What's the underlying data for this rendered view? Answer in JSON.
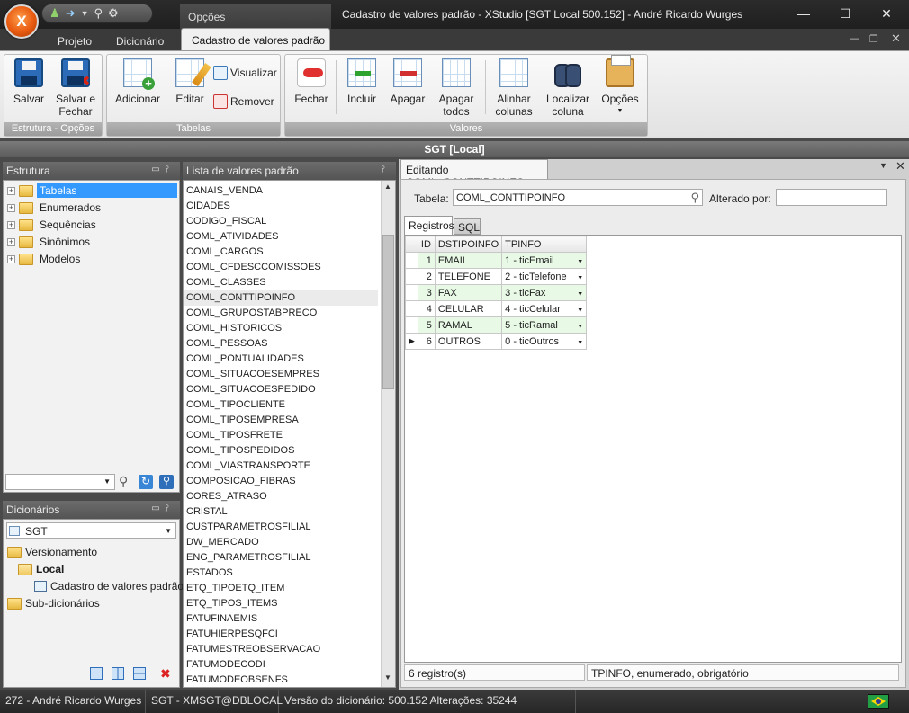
{
  "app": {
    "window_title": "Cadastro de valores padrão - XStudio [SGT Local 500.152] - André Ricardo Wurges",
    "contextual_group": "Opções",
    "logo_letter": "X"
  },
  "ribbon": {
    "tabs": [
      {
        "label": "Projeto"
      },
      {
        "label": "Dicionário"
      },
      {
        "label": "Cadastro de valores padrão"
      }
    ],
    "groups": {
      "estrutura": {
        "caption": "Estrutura - Opções",
        "salvar": "Salvar",
        "salvar_fechar_1": "Salvar e",
        "salvar_fechar_2": "Fechar"
      },
      "tabelas": {
        "caption": "Tabelas",
        "adicionar": "Adicionar",
        "editar": "Editar",
        "visualizar": "Visualizar",
        "remover": "Remover"
      },
      "valores": {
        "caption": "Valores",
        "fechar": "Fechar",
        "incluir": "Incluir",
        "apagar": "Apagar",
        "apagar_todos_1": "Apagar",
        "apagar_todos_2": "todos",
        "alinhar_1": "Alinhar",
        "alinhar_2": "colunas",
        "localizar_1": "Localizar",
        "localizar_2": "coluna",
        "opcoes": "Opções"
      }
    }
  },
  "header_bar": "SGT [Local]",
  "estrutura_panel": {
    "title": "Estrutura",
    "items": [
      "Tabelas",
      "Enumerados",
      "Sequências",
      "Sinônimos",
      "Modelos"
    ],
    "selected": "Tabelas"
  },
  "dicionarios_panel": {
    "title": "Dicionários",
    "selected": "SGT",
    "tree": {
      "versionamento": "Versionamento",
      "local": "Local",
      "cadastro": "Cadastro de valores padrão",
      "sub": "Sub-dicionários"
    }
  },
  "lista_panel": {
    "title": "Lista de valores padrão",
    "selected": "COML_CONTTIPOINFO",
    "items": [
      "CANAIS_VENDA",
      "CIDADES",
      "CODIGO_FISCAL",
      "COML_ATIVIDADES",
      "COML_CARGOS",
      "COML_CFDESCCOMISSOES",
      "COML_CLASSES",
      "COML_CONTTIPOINFO",
      "COML_GRUPOSTABPRECO",
      "COML_HISTORICOS",
      "COML_PESSOAS",
      "COML_PONTUALIDADES",
      "COML_SITUACOESEMPRES",
      "COML_SITUACOESPEDIDO",
      "COML_TIPOCLIENTE",
      "COML_TIPOSEMPRESA",
      "COML_TIPOSFRETE",
      "COML_TIPOSPEDIDOS",
      "COML_VIASTRANSPORTE",
      "COMPOSICAO_FIBRAS",
      "CORES_ATRASO",
      "CRISTAL",
      "CUSTPARAMETROSFILIAL",
      "DW_MERCADO",
      "ENG_PARAMETROSFILIAL",
      "ESTADOS",
      "ETQ_TIPOETQ_ITEM",
      "ETQ_TIPOS_ITEMS",
      "FATUFINAEMIS",
      "FATUHIERPESQFCI",
      "FATUMESTREOBSERVACAO",
      "FATUMODECODI",
      "FATUMODEOBSENFS"
    ]
  },
  "editor": {
    "doc_tab": "Editando COML_CONTTIPOINFO",
    "tabela_label": "Tabela:",
    "tabela_value": "COML_CONTTIPOINFO",
    "alterado_label": "Alterado por:",
    "alterado_value": "",
    "subtabs": [
      "Registros",
      "SQL"
    ],
    "columns": [
      "ID",
      "DSTIPOINFO",
      "TPINFO"
    ],
    "rows": [
      {
        "id": "1",
        "ds": "EMAIL",
        "tp": "1 - ticEmail"
      },
      {
        "id": "2",
        "ds": "TELEFONE",
        "tp": "2 - ticTelefone"
      },
      {
        "id": "3",
        "ds": "FAX",
        "tp": "3 - ticFax"
      },
      {
        "id": "4",
        "ds": "CELULAR",
        "tp": "4 - ticCelular"
      },
      {
        "id": "5",
        "ds": "RAMAL",
        "tp": "5 - ticRamal"
      },
      {
        "id": "6",
        "ds": "OUTROS",
        "tp": "0 - ticOutros"
      }
    ],
    "status_left": "6 registro(s)",
    "status_right": "TPINFO, enumerado, obrigatório"
  },
  "statusbar": {
    "user": "272 - André Ricardo Wurges",
    "conn": "SGT - XMSGT@DBLOCAL",
    "version": "Versão do dicionário: 500.152 Alterações: 35244"
  },
  "colors": {
    "row_green": "#e8f9e6",
    "selection": "#3399ff",
    "chrome_dark": "#2b2b2b"
  }
}
